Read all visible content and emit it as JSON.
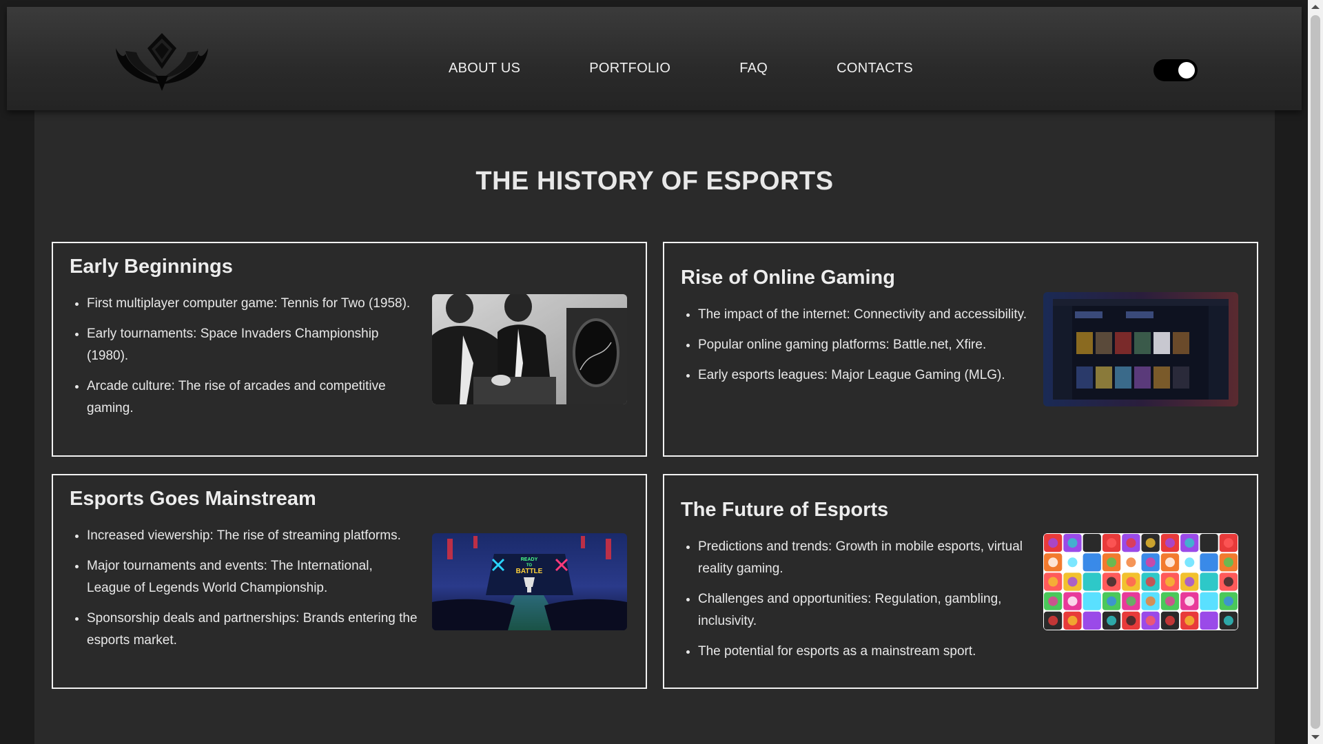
{
  "nav": {
    "items": [
      "ABOUT US",
      "PORTFOLIO",
      "FAQ",
      "CONTACTS"
    ]
  },
  "theme_toggle": {
    "state": "on"
  },
  "page": {
    "title": "THE HISTORY OF ESPORTS"
  },
  "cards": [
    {
      "title": "Early Beginnings",
      "image": "black-and-white-vintage-computer-photo",
      "items": [
        "First multiplayer computer game: Tennis for Two (1958).",
        "Early tournaments: Space Invaders Championship (1980).",
        "Arcade culture: The rise of arcades and competitive gaming."
      ]
    },
    {
      "title": "Rise of Online Gaming",
      "image": "game-launcher-screenshot",
      "items": [
        "The impact of the internet: Connectivity and accessibility.",
        "Popular online gaming platforms: Battle.net, Xfire.",
        "Early esports leagues: Major League Gaming (MLG)."
      ]
    },
    {
      "title": "Esports Goes Mainstream",
      "image": "esports-arena-ready-to-battle",
      "image_text": [
        "READY",
        "TO",
        "BATTLE"
      ],
      "items": [
        "Increased viewership: The rise of streaming platforms.",
        "Major tournaments and events: The International, League of Legends World Championship.",
        "Sponsorship deals and partnerships: Brands entering the esports market."
      ]
    },
    {
      "title": "The Future of Esports",
      "image": "mobile-game-icons-grid",
      "items": [
        "Predictions and trends: Growth in mobile esports, virtual reality gaming.",
        "Challenges and opportunities: Regulation, gambling, inclusivity.",
        "The potential for esports as a mainstream sport."
      ]
    }
  ],
  "colors": {
    "page_bg": "#1c1c1c",
    "content_bg": "#2a2a2a",
    "card_border": "#f2f2f2",
    "text": "#e6e6e6"
  }
}
